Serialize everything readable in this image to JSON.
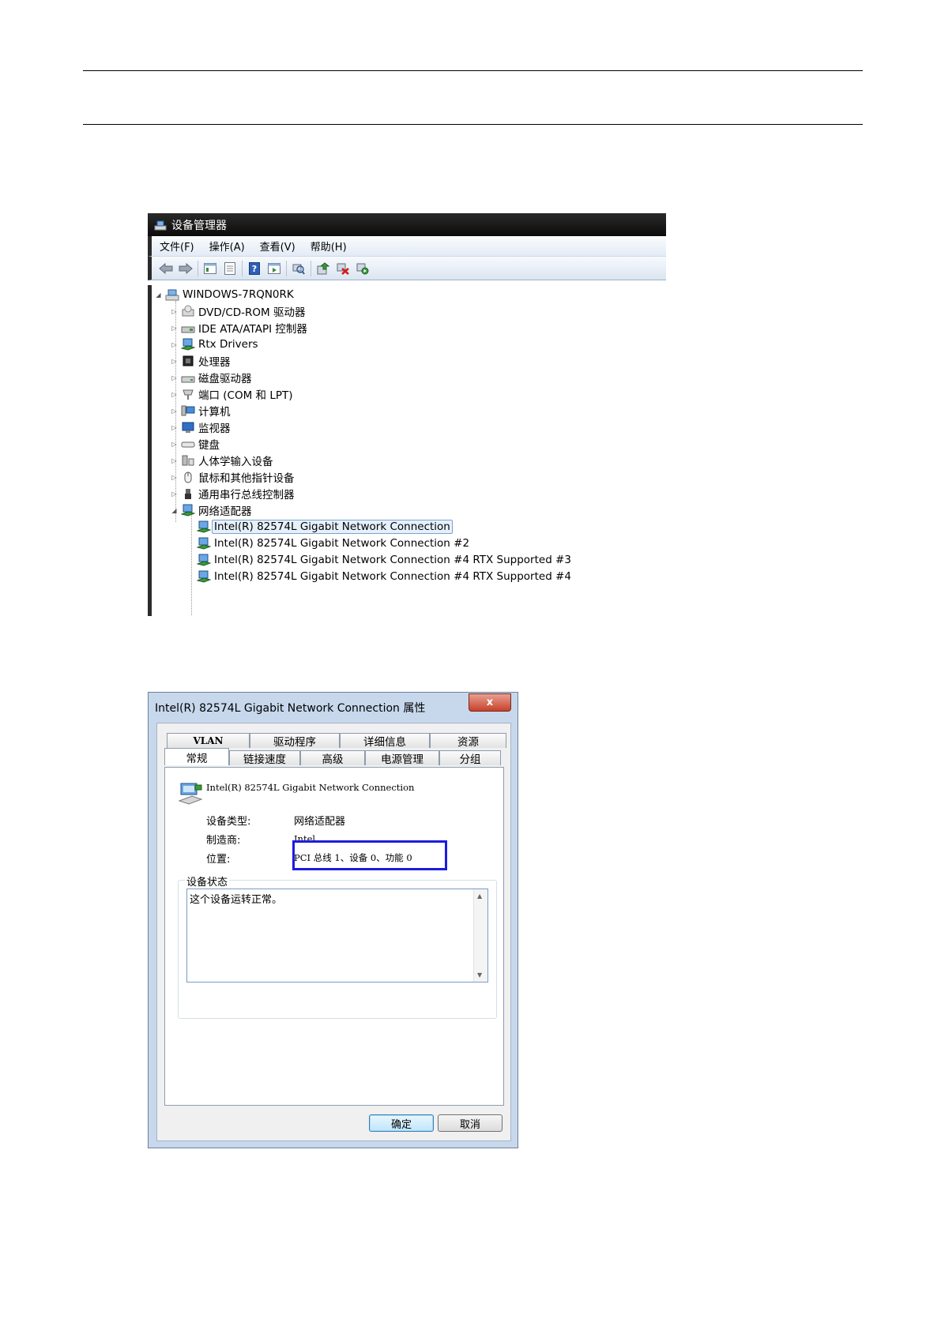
{
  "device_manager": {
    "title": "设备管理器",
    "menu": [
      "文件(F)",
      "操作(A)",
      "查看(V)",
      "帮助(H)"
    ],
    "toolbar_icons": [
      "back-icon",
      "forward-icon",
      "sep",
      "console-tree-icon",
      "properties-sheet-icon",
      "sep",
      "help-icon",
      "action-pane-icon",
      "sep",
      "scan-hardware-icon",
      "sep",
      "update-driver-icon",
      "uninstall-icon",
      "enable-device-icon"
    ],
    "tree": {
      "root": "WINDOWS-7RQN0RK",
      "categories": [
        {
          "label": "DVD/CD-ROM 驱动器",
          "icon": "dvd-drive-icon"
        },
        {
          "label": "IDE ATA/ATAPI 控制器",
          "icon": "ide-controller-icon"
        },
        {
          "label": "Rtx Drivers",
          "icon": "network-adapter-icon"
        },
        {
          "label": "处理器",
          "icon": "processor-icon"
        },
        {
          "label": "磁盘驱动器",
          "icon": "disk-drive-icon"
        },
        {
          "label": "端口 (COM 和 LPT)",
          "icon": "port-icon"
        },
        {
          "label": "计算机",
          "icon": "computer-icon"
        },
        {
          "label": "监视器",
          "icon": "monitor-icon"
        },
        {
          "label": "键盘",
          "icon": "keyboard-icon"
        },
        {
          "label": "人体学输入设备",
          "icon": "hid-icon"
        },
        {
          "label": "鼠标和其他指针设备",
          "icon": "mouse-icon"
        },
        {
          "label": "通用串行总线控制器",
          "icon": "usb-icon"
        },
        {
          "label": "网络适配器",
          "icon": "network-adapter-icon"
        }
      ],
      "adapters": [
        "Intel(R) 82574L Gigabit Network Connection",
        "Intel(R) 82574L Gigabit Network Connection #2",
        "Intel(R) 82574L Gigabit Network Connection #4 RTX Supported #3",
        "Intel(R) 82574L Gigabit Network Connection #4 RTX Supported #4"
      ]
    }
  },
  "properties_dialog": {
    "title": "Intel(R) 82574L Gigabit Network Connection 属性",
    "close_label": "x",
    "tabs_top": [
      "VLAN",
      "驱动程序",
      "详细信息",
      "资源"
    ],
    "tabs_bottom": [
      "常规",
      "链接速度",
      "高级",
      "电源管理",
      "分组"
    ],
    "device_name": "Intel(R) 82574L Gigabit Network Connection",
    "device_type_label": "设备类型:",
    "device_type_value": "网络适配器",
    "manufacturer_label": "制造商:",
    "manufacturer_value": "Intel",
    "location_label": "位置:",
    "location_value": "PCI 总线 1、设备 0、功能 0",
    "status_group_label": "设备状态",
    "status_text": "这个设备运转正常。",
    "ok_label": "确定",
    "cancel_label": "取消",
    "highlight_color": "#1c1ce0"
  }
}
